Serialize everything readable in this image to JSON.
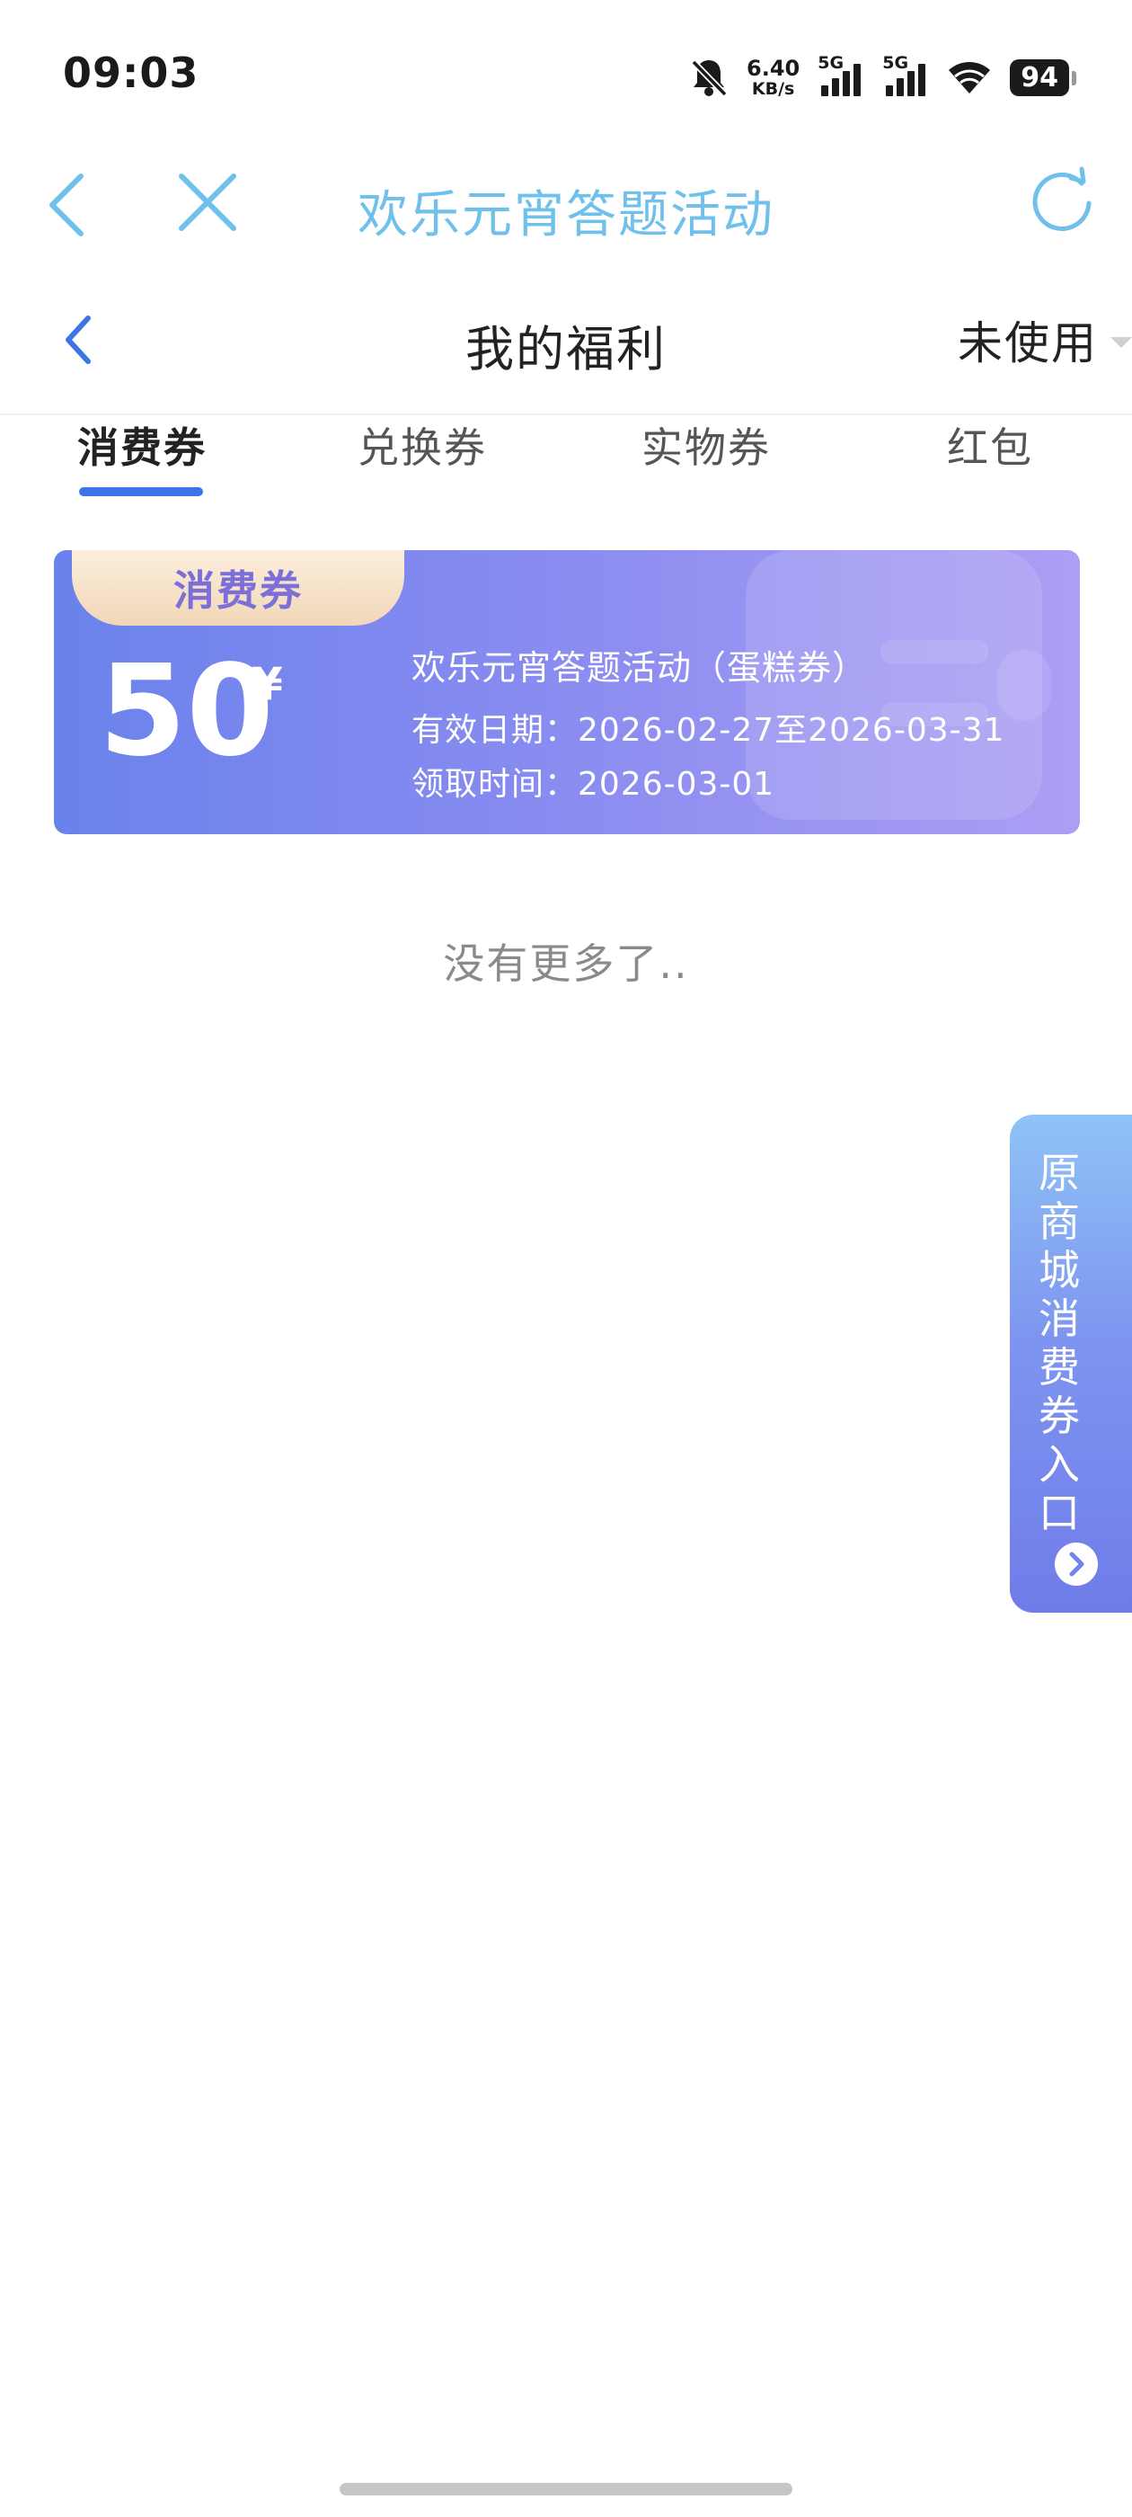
{
  "status_bar": {
    "time": "09:03",
    "net_speed_value": "6.40",
    "net_speed_unit": "KB/s",
    "signal1_label": "5G",
    "signal2_label": "5G",
    "battery": "94"
  },
  "browser_header": {
    "title": "欢乐元宵答题活动"
  },
  "app_header": {
    "title": "我的福利",
    "filter_value": "未使用"
  },
  "tabs": [
    {
      "label": "消费券",
      "active": true
    },
    {
      "label": "兑换券",
      "active": false
    },
    {
      "label": "实物券",
      "active": false
    },
    {
      "label": "红包",
      "active": false
    }
  ],
  "coupon": {
    "tag": "消费券",
    "amount": "50",
    "currency": "¥",
    "name": "欢乐元宵答题活动（蛋糕券）",
    "valid_period": "有效日期：2026-02-27至2026-03-31",
    "received_time": "领取时间：2026-03-01"
  },
  "list_end_text": "没有更多了..",
  "side_entry": {
    "chars": [
      "原",
      "商",
      "城",
      "消",
      "费",
      "券",
      "入",
      "口"
    ]
  },
  "colors": {
    "accent": "#3d74e6",
    "browser_title": "#6fc0ea",
    "coupon_start": "#6a82ec",
    "coupon_end": "#ac9ef4",
    "tag": "#f2d7b8"
  },
  "icons": [
    "bell-muted-icon",
    "back-arrow-icon",
    "close-icon",
    "refresh-icon",
    "wifi-icon",
    "chevron-right-icon"
  ]
}
